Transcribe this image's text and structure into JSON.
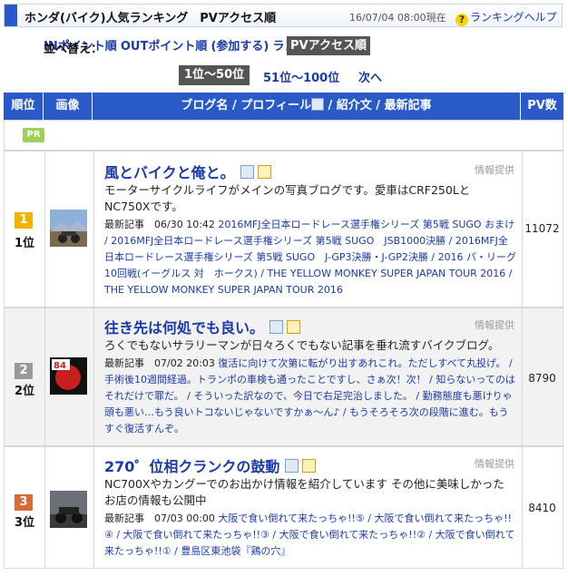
{
  "header": {
    "title": "ホンダ(バイク)人気ランキング　PVアクセス順",
    "timestamp": "16/07/04 08:00現在",
    "help_label": "ランキングヘルプ"
  },
  "sort": {
    "label": "並べ替え：",
    "options": [
      "INポイント順",
      "OUTポイント順",
      "PVアクセス順",
      "(参加する)",
      "ランダム表示"
    ],
    "active": "PVアクセス順"
  },
  "pages": {
    "active": "1位〜50位",
    "next_range": "51位〜100位",
    "next": "次へ"
  },
  "table": {
    "col_rank": "順位",
    "col_image": "画像",
    "col_blog": "ブログ名 / プロフィール",
    "col_blog_rest": " / 紹介文 / 最新記事",
    "col_pv": "PV数",
    "pr_badge": "PR",
    "info_label": "情報提供"
  },
  "entries": [
    {
      "rank_num": "1",
      "rank_label": "1位",
      "title": "風とバイクと俺と。",
      "description": "モーターサイクルライフがメインの写真ブログです。愛車はCRF250LとNC750Xです。",
      "articles_lead": "最新記事　06/30 10:42",
      "articles": "2016MFJ全日本ロードレース選手権シリーズ 第5戦 SUGO おまけ / 2016MFJ全日本ロードレース選手権シリーズ 第5戦 SUGO　JSB1000決勝 / 2016MFJ全日本ロードレース選手権シリーズ 第5戦 SUGO　J-GP3決勝・J-GP2決勝 / 2016 パ・リーグ10回戦(イーグルス 対　ホークス) / THE YELLOW MONKEY SUPER JAPAN TOUR 2016 / THE YELLOW MONKEY SUPER JAPAN TOUR 2016",
      "pv": "11072",
      "badge_color": "#f0b400"
    },
    {
      "rank_num": "2",
      "rank_label": "2位",
      "title": "往き先は何処でも良い。",
      "description": "ろくでもないサラリーマンが日々ろくでもない記事を垂れ流すバイクブログ。",
      "articles_lead": "最新記事　07/02 20:03",
      "articles": "復活に向けて次第に転がり出すあれこれ。ただしすべて丸投げ。 / 手術後10週間経過。トランポの車検も通ったことですし、さぁ次！次！ / 知らないってのはそれだけで罪だ。 / そういった訳なので、今日で右足完治しました。 / 勤務態度も悪けりゃ頭も悪い…もう良いトコないじゃないですかぁ〜ん♪ / もうそろそろ次の段階に進む。もうすぐ復活すんぞ。",
      "pv": "8790",
      "badge_color": "#9a9a9a",
      "thumb_text": "84"
    },
    {
      "rank_num": "3",
      "rank_label": "3位",
      "title": "270゜位相クランクの鼓動",
      "description": "NC700Xやカングーでのお出かけ情報を紹介しています その他に美味しかったお店の情報も公開中",
      "articles_lead": "最新記事　07/03 00:00",
      "articles": "大阪で食い倒れて来たっちゃ!!⑤ / 大阪で食い倒れて来たっちゃ!!④ / 大阪で食い倒れて来たっちゃ!!③ / 大阪で食い倒れて来たっちゃ!!② / 大阪で食い倒れて来たっちゃ!!① / 豊島区東池袋『鶏の穴』",
      "pv": "8410",
      "badge_color": "#d96a3a"
    }
  ]
}
